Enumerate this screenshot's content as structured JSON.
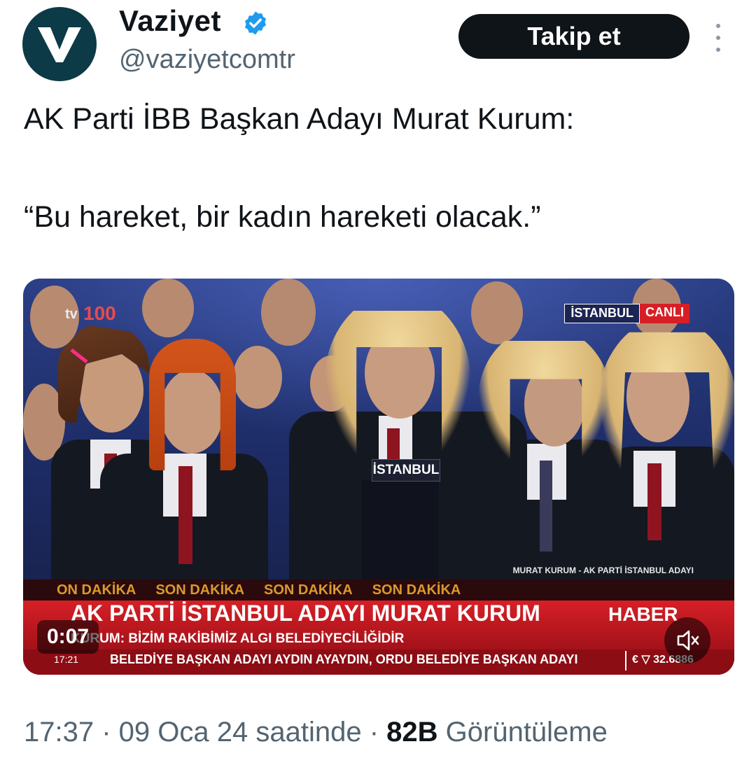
{
  "account": {
    "name": "Vaziyet",
    "handle": "@vaziyetcomtr",
    "verified": true,
    "avatar_icon": "vaziyet-v-logo"
  },
  "follow_label": "Takip et",
  "tweet": {
    "line1": "AK Parti İBB Başkan Adayı Murat Kurum:",
    "line2": "“Bu hareket, bir kadın hareketi olacak.”"
  },
  "video": {
    "duration": "0:07",
    "channel_logo": "tv",
    "channel_logo_suffix": "100",
    "live_city": "İSTANBUL",
    "live_label": "CANLI",
    "podium_label": "İSTANBUL",
    "top_caption": "MURAT KURUM - AK PARTİ İSTANBUL ADAYI",
    "breaking": [
      "ON DAKİKA",
      "SON DAKİKA",
      "SON DAKİKA",
      "SON DAKİKA"
    ],
    "headline": "AK PARTİ İSTANBUL ADAYI MURAT KURUM",
    "brand": "HABER",
    "subline": "KURUM: BİZİM RAKİBİMİZ ALGI BELEDİYECİLİĞİDİR",
    "ticker_time": "17:21",
    "ticker_text": "BELEDİYE BAŞKAN ADAYI AYDIN AYAYDIN, ORDU BELEDİYE BAŞKAN ADAYI",
    "ticker_rate": "€ ▽ 32.6886",
    "mute_icon": "speaker-muted-icon"
  },
  "footer": {
    "time": "17:37",
    "separator": " · ",
    "date": "09 Oca 24 saatinde",
    "views_count": "82B",
    "views_label": "Görüntüleme"
  },
  "colors": {
    "text": "#0f1419",
    "secondary": "#536471",
    "verified_blue": "#1d9bf0",
    "chyron_red": "#d71f26"
  }
}
